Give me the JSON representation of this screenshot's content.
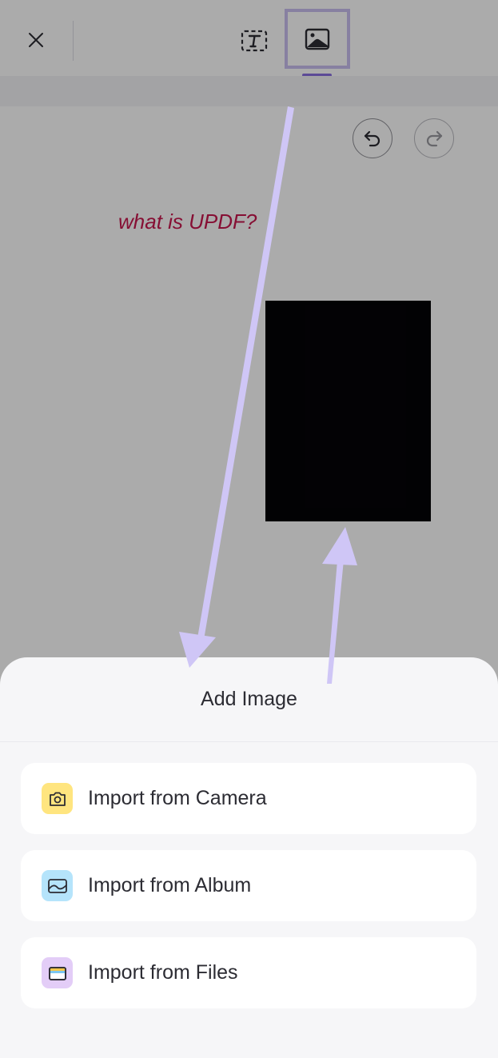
{
  "toolbar": {
    "close_icon": "close-icon",
    "text_tool_icon": "text-box-icon",
    "image_tool_icon": "image-icon",
    "active_tool": "image",
    "highlight_color": "#c9bff1",
    "active_color": "#8a6fe0"
  },
  "canvas": {
    "undo_icon": "undo-icon",
    "redo_icon": "redo-icon",
    "annotation_text": "what is UPDF?",
    "annotation_color": "#c8174e"
  },
  "sheet": {
    "title": "Add Image",
    "options": [
      {
        "label": "Import from Camera",
        "icon": "camera-icon",
        "icon_bg": "#ffe57f"
      },
      {
        "label": "Import from Album",
        "icon": "album-icon",
        "icon_bg": "#b5e4fb"
      },
      {
        "label": "Import from Files",
        "icon": "folder-icon",
        "icon_bg": "#e3cdf7"
      }
    ]
  },
  "guide_arrow_color": "#cfc6f6"
}
